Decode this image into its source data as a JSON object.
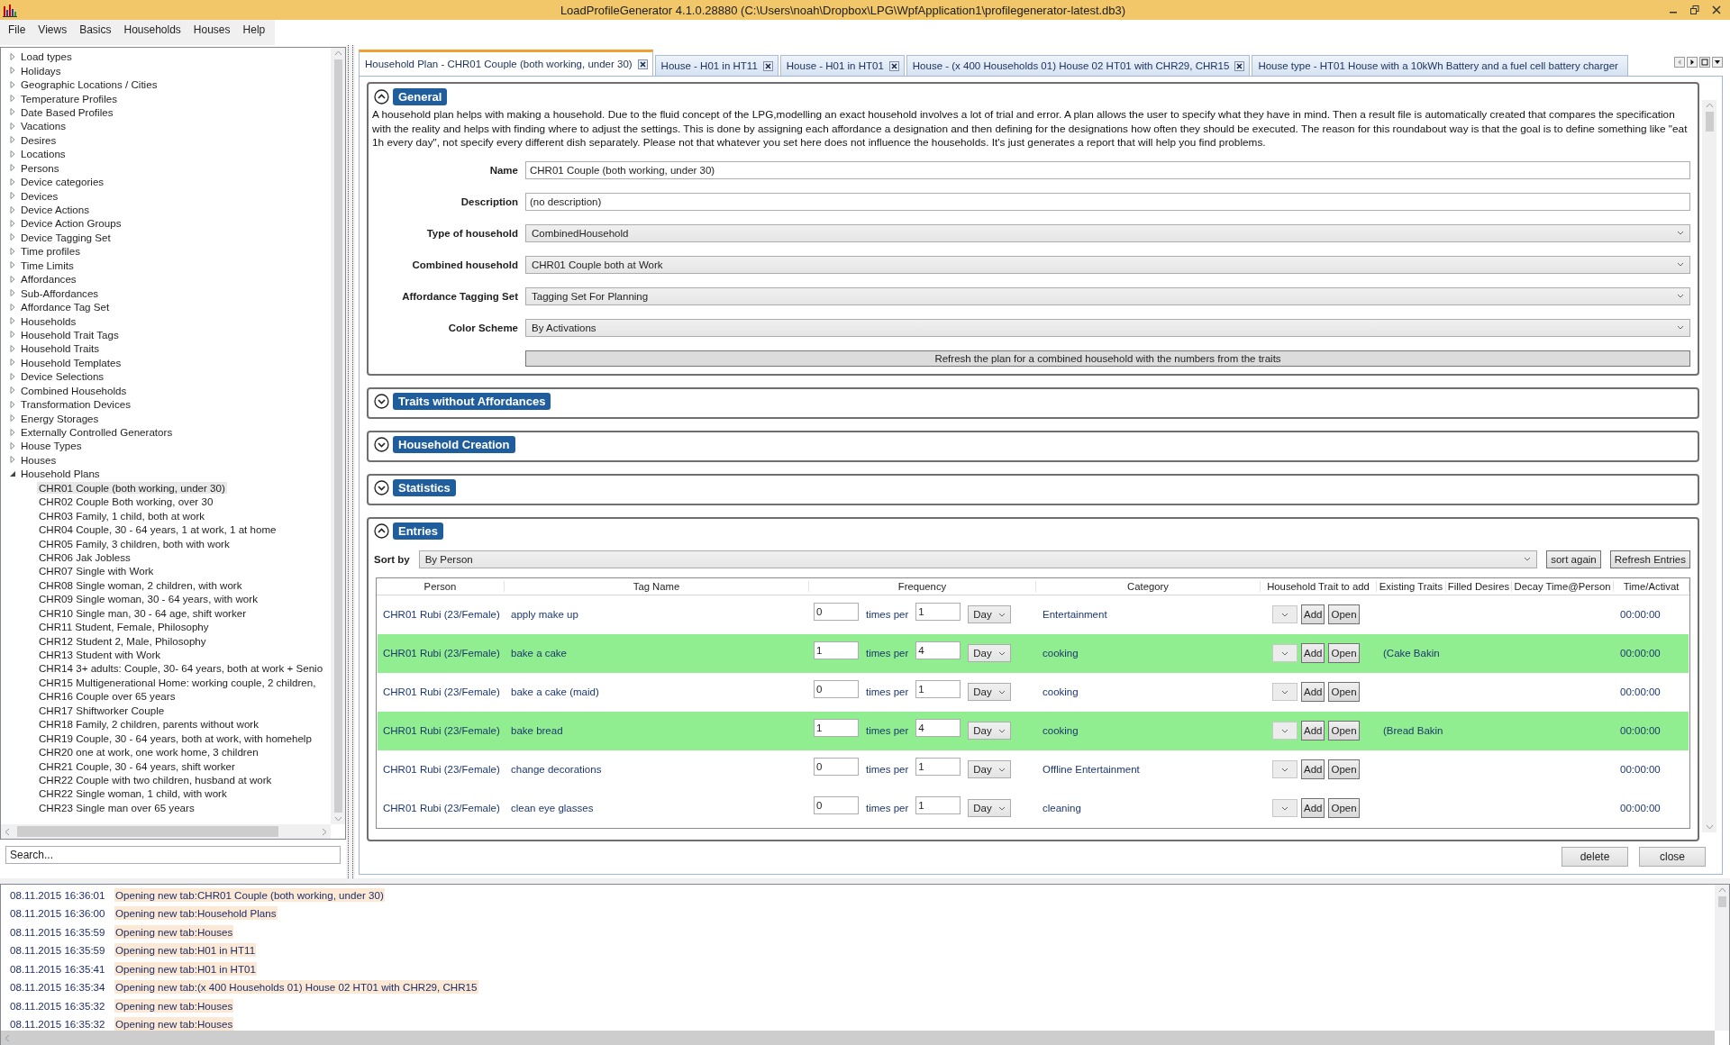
{
  "window": {
    "title": "LoadProfileGenerator 4.1.0.28880 (C:\\Users\\noah\\Dropbox\\LPG\\WpfApplication1\\profilegenerator-latest.db3)"
  },
  "menu": [
    "File",
    "Views",
    "Basics",
    "Households",
    "Houses",
    "Help"
  ],
  "sidebar": {
    "items": [
      {
        "label": "Load types",
        "expanded": false
      },
      {
        "label": "Holidays",
        "expanded": false
      },
      {
        "label": "Geographic Locations / Cities",
        "expanded": false
      },
      {
        "label": "Temperature Profiles",
        "expanded": false
      },
      {
        "label": "Date Based Profiles",
        "expanded": false
      },
      {
        "label": "Vacations",
        "expanded": false
      },
      {
        "label": "Desires",
        "expanded": false
      },
      {
        "label": "Locations",
        "expanded": false
      },
      {
        "label": "Persons",
        "expanded": false
      },
      {
        "label": "Device categories",
        "expanded": false
      },
      {
        "label": "Devices",
        "expanded": false
      },
      {
        "label": "Device Actions",
        "expanded": false
      },
      {
        "label": "Device Action Groups",
        "expanded": false
      },
      {
        "label": "Device Tagging Set",
        "expanded": false
      },
      {
        "label": "Time profiles",
        "expanded": false
      },
      {
        "label": "Time Limits",
        "expanded": false
      },
      {
        "label": "Affordances",
        "expanded": false
      },
      {
        "label": "Sub-Affordances",
        "expanded": false
      },
      {
        "label": "Affordance Tag Set",
        "expanded": false
      },
      {
        "label": "Households",
        "expanded": false
      },
      {
        "label": "Household Trait Tags",
        "expanded": false
      },
      {
        "label": "Household Traits",
        "expanded": false
      },
      {
        "label": "Household Templates",
        "expanded": false
      },
      {
        "label": "Device Selections",
        "expanded": false
      },
      {
        "label": "Combined Households",
        "expanded": false
      },
      {
        "label": "Transformation Devices",
        "expanded": false
      },
      {
        "label": "Energy Storages",
        "expanded": false
      },
      {
        "label": "Externally Controlled Generators",
        "expanded": false
      },
      {
        "label": "House Types",
        "expanded": false
      },
      {
        "label": "Houses",
        "expanded": false
      },
      {
        "label": "Household Plans",
        "expanded": true,
        "children": [
          {
            "label": "CHR01 Couple (both working, under 30)",
            "selected": true
          },
          {
            "label": "CHR02 Couple Both working, over 30",
            "selected": false
          },
          {
            "label": "CHR03 Family, 1 child, both at work",
            "selected": false
          },
          {
            "label": "CHR04 Couple, 30 - 64 years, 1 at work, 1 at home",
            "selected": false
          },
          {
            "label": "CHR05 Family, 3 children, both with work",
            "selected": false
          },
          {
            "label": "CHR06 Jak Jobless",
            "selected": false
          },
          {
            "label": "CHR07 Single with Work",
            "selected": false
          },
          {
            "label": "CHR08 Single woman, 2 children, with work",
            "selected": false
          },
          {
            "label": "CHR09 Single woman, 30 - 64 years, with work",
            "selected": false
          },
          {
            "label": "CHR10 Single man, 30 - 64 age, shift worker",
            "selected": false
          },
          {
            "label": "CHR11 Student, Female, Philosophy",
            "selected": false
          },
          {
            "label": "CHR12 Student 2, Male, Philosophy",
            "selected": false
          },
          {
            "label": "CHR13 Student with Work",
            "selected": false
          },
          {
            "label": "CHR14 3+ adults: Couple, 30- 64 years, both at work + Senio",
            "selected": false
          },
          {
            "label": "CHR15 Multigenerational Home: working couple, 2 children,",
            "selected": false
          },
          {
            "label": "CHR16 Couple over 65 years",
            "selected": false
          },
          {
            "label": "CHR17 Shiftworker Couple",
            "selected": false
          },
          {
            "label": "CHR18 Family, 2 children, parents without work",
            "selected": false
          },
          {
            "label": "CHR19 Couple, 30 - 64 years, both at work, with homehelp",
            "selected": false
          },
          {
            "label": "CHR20 one at work, one work home, 3 children",
            "selected": false
          },
          {
            "label": "CHR21 Couple, 30 - 64 years, shift worker",
            "selected": false
          },
          {
            "label": "CHR22 Couple with two children, husband at work",
            "selected": false
          },
          {
            "label": "CHR22 Single woman, 1 child, with work",
            "selected": false
          },
          {
            "label": "CHR23 Single man over 65 years",
            "selected": false
          }
        ]
      }
    ],
    "search": {
      "placeholder": "Search..."
    }
  },
  "tabs": [
    {
      "label": "Household Plan - CHR01 Couple (both working, under 30)",
      "selected": true
    },
    {
      "label": "House - H01 in HT11",
      "selected": false
    },
    {
      "label": "House - H01 in HT01",
      "selected": false
    },
    {
      "label": "House - (x 400 Households 01) House 02 HT01 with CHR29, CHR15",
      "selected": false
    },
    {
      "label": "House type - HT01 House with a 10kWh Battery and a fuel cell battery charger",
      "selected": false
    }
  ],
  "sections": [
    {
      "kind": "general",
      "title": "General",
      "expanded": true,
      "intro": "A household plan helps with making a household. Due to the fluid concept of the LPG,modelling an exact household involves a lot of trial and error. A plan allows the user to specify what they have in mind. Then a result file is automatically created that compares the specification with the reality and helps with finding where to adjust the settings. This is done by assigning each affordance a designation and then defining for the designations how often they should be executed. The reason for this roundabout way is that the goal is to define something like \"eat 1h every day\", not specify every different dish separately. Please not that whatever you set here does not influence the households. It's just generates a report that will help you find problems.",
      "fields": [
        {
          "label": "Name",
          "kind": "text",
          "value": "CHR01 Couple (both working, under 30)"
        },
        {
          "label": "Description",
          "kind": "text",
          "value": "(no description)"
        },
        {
          "label": "Type of household",
          "kind": "combo",
          "value": "CombinedHousehold"
        },
        {
          "label": "Combined household",
          "kind": "combo",
          "value": "CHR01 Couple both at Work"
        },
        {
          "label": "Affordance Tagging Set",
          "kind": "combo",
          "value": "Tagging Set For Planning"
        },
        {
          "label": "Color Scheme",
          "kind": "combo",
          "value": "By Activations"
        }
      ],
      "refresh_button": "Refresh the plan for a combined household with the numbers from the traits"
    },
    {
      "kind": "plain",
      "title": "Traits without Affordances",
      "expanded": false
    },
    {
      "kind": "plain",
      "title": "Household Creation",
      "expanded": false
    },
    {
      "kind": "plain",
      "title": "Statistics",
      "expanded": false
    },
    {
      "kind": "entries",
      "title": "Entries",
      "expanded": true,
      "sort_label": "Sort by",
      "sort_value": "By Person",
      "buttons": [
        "sort again",
        "Refresh Entries"
      ],
      "columns": [
        "Person",
        "Tag Name",
        "Frequency",
        "Category",
        "Household Trait to add",
        "Existing Traits",
        "Filled Desires",
        "Decay Time@Person",
        "Time/Activat"
      ],
      "rows": [
        {
          "person": "CHR01 Rubi (23/Female)",
          "tag": "apply make up",
          "count": "0",
          "times_per": "times per",
          "interval": "1",
          "unit": "Day",
          "category": "Entertainment",
          "add": "Add",
          "open": "Open",
          "time": "00:00:00",
          "highlighted": false
        },
        {
          "person": "CHR01 Rubi (23/Female)",
          "tag": "bake a cake",
          "count": "1",
          "times_per": "times per",
          "interval": "4",
          "unit": "Day",
          "category": "cooking",
          "add": "Add",
          "open": "Open",
          "existing": "(Cake Bakin",
          "time": "00:00:00",
          "highlighted": true
        },
        {
          "person": "CHR01 Rubi (23/Female)",
          "tag": "bake a cake (maid)",
          "count": "0",
          "times_per": "times per",
          "interval": "1",
          "unit": "Day",
          "category": "cooking",
          "add": "Add",
          "open": "Open",
          "time": "00:00:00",
          "highlighted": false
        },
        {
          "person": "CHR01 Rubi (23/Female)",
          "tag": "bake bread",
          "count": "1",
          "times_per": "times per",
          "interval": "4",
          "unit": "Day",
          "category": "cooking",
          "add": "Add",
          "open": "Open",
          "existing": "(Bread Bakin",
          "time": "00:00:00",
          "highlighted": true
        },
        {
          "person": "CHR01 Rubi (23/Female)",
          "tag": "change decorations",
          "count": "0",
          "times_per": "times per",
          "interval": "1",
          "unit": "Day",
          "category": "Offline Entertainment",
          "add": "Add",
          "open": "Open",
          "time": "00:00:00",
          "highlighted": false
        },
        {
          "person": "CHR01 Rubi (23/Female)",
          "tag": "clean eye glasses",
          "count": "0",
          "times_per": "times per",
          "interval": "1",
          "unit": "Day",
          "category": "cleaning",
          "add": "Add",
          "open": "Open",
          "time": "00:00:00",
          "highlighted": false
        }
      ]
    }
  ],
  "footer_buttons": [
    "delete",
    "close"
  ],
  "log": [
    {
      "time": "08.11.2015 16:36:01",
      "message": "Opening new tab:CHR01 Couple (both working, under 30)"
    },
    {
      "time": "08.11.2015 16:36:00",
      "message": "Opening new tab:Household Plans"
    },
    {
      "time": "08.11.2015 16:35:59",
      "message": "Opening new tab:Houses"
    },
    {
      "time": "08.11.2015 16:35:59",
      "message": "Opening new tab:H01 in HT11"
    },
    {
      "time": "08.11.2015 16:35:41",
      "message": "Opening new tab:H01 in HT01"
    },
    {
      "time": "08.11.2015 16:35:34",
      "message": "Opening new tab:(x 400 Households 01) House 02 HT01 with CHR29, CHR15"
    },
    {
      "time": "08.11.2015 16:35:32",
      "message": "Opening new tab:Houses"
    },
    {
      "time": "08.11.2015 16:35:32",
      "message": "Opening new tab:Houses"
    }
  ]
}
